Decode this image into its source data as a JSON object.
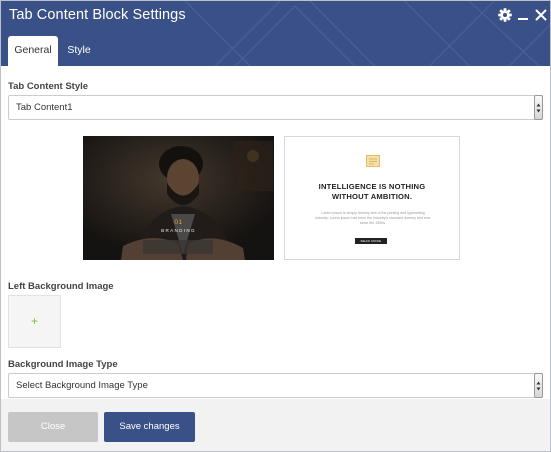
{
  "window": {
    "title": "Tab Content Block Settings"
  },
  "header": {
    "icons": [
      "gear-icon",
      "minimize-icon",
      "close-icon"
    ]
  },
  "tabs": [
    {
      "label": "General",
      "active": true
    },
    {
      "label": "Style",
      "active": false
    }
  ],
  "tab_content_style": {
    "label": "Tab Content Style",
    "value": "Tab Content1"
  },
  "preview_left": {
    "number": "01",
    "caption": "BRANDING"
  },
  "preview_right": {
    "headline_line1": "INTELLIGENCE IS NOTHING",
    "headline_line2": "WITHOUT AMBITION.",
    "body": "Lorem ipsum is simply dummy text of the printing and typesetting industry. Lorem ipsum has been the industry's standard dummy text ever since the 1500s.",
    "button": "READ MORE"
  },
  "left_background_image": {
    "label": "Left Background Image",
    "add_symbol": "+"
  },
  "background_image_type": {
    "label": "Background Image Type",
    "value": "Select Background Image Type"
  },
  "footer": {
    "close_label": "Close",
    "save_label": "Save changes"
  },
  "colors": {
    "header_bg": "#3a5188",
    "save_button_bg": "#3a5188",
    "close_button_bg": "#c6c6c6",
    "plus_green": "#7cbf3a",
    "number_gold": "#d9a54a"
  }
}
